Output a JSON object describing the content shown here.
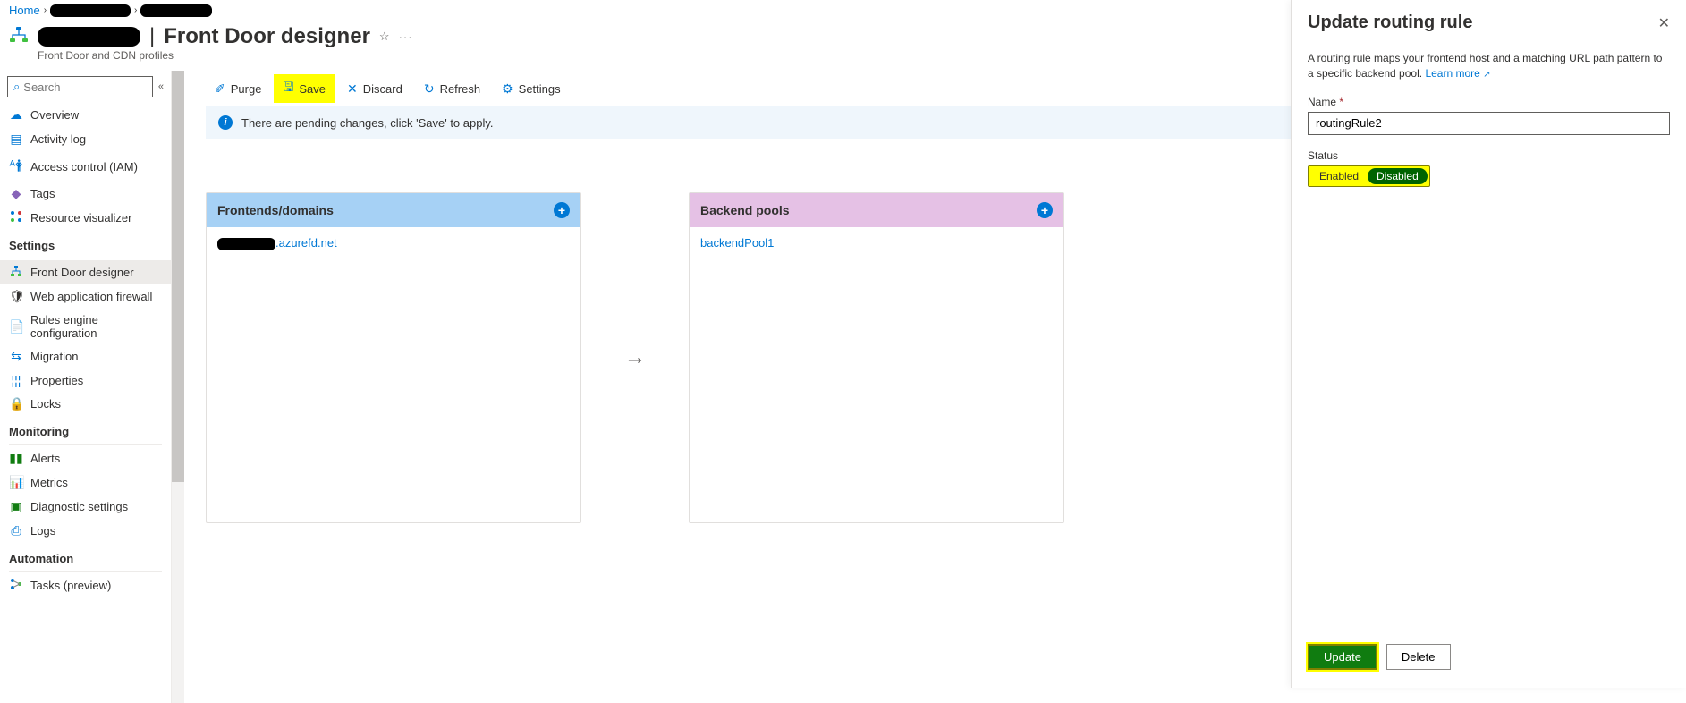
{
  "breadcrumb": {
    "home": "Home"
  },
  "title": {
    "separator": "|",
    "page": "Front Door designer",
    "subtitle": "Front Door and CDN profiles"
  },
  "sidebar": {
    "search_placeholder": "Search",
    "items": [
      {
        "label": "Overview",
        "icon": "☁"
      },
      {
        "label": "Activity log",
        "icon": "▤"
      },
      {
        "label": "Access control (IAM)",
        "icon": "ᴬ"
      },
      {
        "label": "Tags",
        "icon": "◆"
      },
      {
        "label": "Resource visualizer",
        "icon": "⋮"
      }
    ],
    "groups": [
      {
        "title": "Settings",
        "items": [
          {
            "label": "Front Door designer",
            "icon": "⋮",
            "active": true
          },
          {
            "label": "Web application firewall",
            "icon": "🌐"
          },
          {
            "label": "Rules engine configuration",
            "icon": "📄"
          },
          {
            "label": "Migration",
            "icon": "↻"
          },
          {
            "label": "Properties",
            "icon": "≡"
          },
          {
            "label": "Locks",
            "icon": "🔒"
          }
        ]
      },
      {
        "title": "Monitoring",
        "items": [
          {
            "label": "Alerts",
            "icon": "▮"
          },
          {
            "label": "Metrics",
            "icon": "📊"
          },
          {
            "label": "Diagnostic settings",
            "icon": "▣"
          },
          {
            "label": "Logs",
            "icon": "⎙"
          }
        ]
      },
      {
        "title": "Automation",
        "items": [
          {
            "label": "Tasks (preview)",
            "icon": "⋮"
          }
        ]
      }
    ]
  },
  "toolbar": {
    "purge": "Purge",
    "save": "Save",
    "discard": "Discard",
    "refresh": "Refresh",
    "settings": "Settings"
  },
  "banner": {
    "text": "There are pending changes, click 'Save' to apply."
  },
  "cards": {
    "frontends": {
      "title": "Frontends/domains",
      "item_suffix": ".azurefd.net"
    },
    "backends": {
      "title": "Backend pools",
      "item": "backendPool1"
    }
  },
  "panel": {
    "title": "Update routing rule",
    "desc": "A routing rule maps your frontend host and a matching URL path pattern to a specific backend pool.",
    "learn_more": "Learn more",
    "name_label": "Name",
    "name_value": "routingRule2",
    "status_label": "Status",
    "enabled": "Enabled",
    "disabled": "Disabled",
    "update": "Update",
    "delete": "Delete"
  }
}
